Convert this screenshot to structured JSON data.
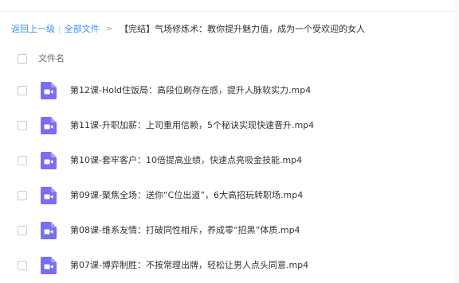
{
  "breadcrumb": {
    "back_label": "返回上一级",
    "divider": "|",
    "all_files_label": "全部文件",
    "arrow": ">",
    "current_folder": "【完结】气场修炼术：教你提升魅力值，成为一个受欢迎的女人"
  },
  "list_header": {
    "column_label": "文件名"
  },
  "files": [
    {
      "name": "第12课-Hold住饭局：高段位刷存在感，提升人脉软实力.mp4",
      "icon": "video-file-icon"
    },
    {
      "name": "第11课-升职加薪：上司重用信赖，5个秘诀实现快速晋升.mp4",
      "icon": "video-file-icon"
    },
    {
      "name": "第10课-套牢客户：10倍提高业绩，快速点亮吸金技能.mp4",
      "icon": "video-file-icon"
    },
    {
      "name": "第09课-聚焦全场：送你“C位出道”，6大高招玩转职场.mp4",
      "icon": "video-file-icon"
    },
    {
      "name": "第08课-维系友情：打破同性相斥，养成零“招黑”体质.mp4",
      "icon": "video-file-icon"
    },
    {
      "name": "第07课-博弈制胜：不按常理出牌，轻松让男人点头同意.mp4",
      "icon": "video-file-icon"
    }
  ],
  "colors": {
    "link": "#3b8cff",
    "video_icon": "#7b6df0",
    "text": "#333333"
  }
}
